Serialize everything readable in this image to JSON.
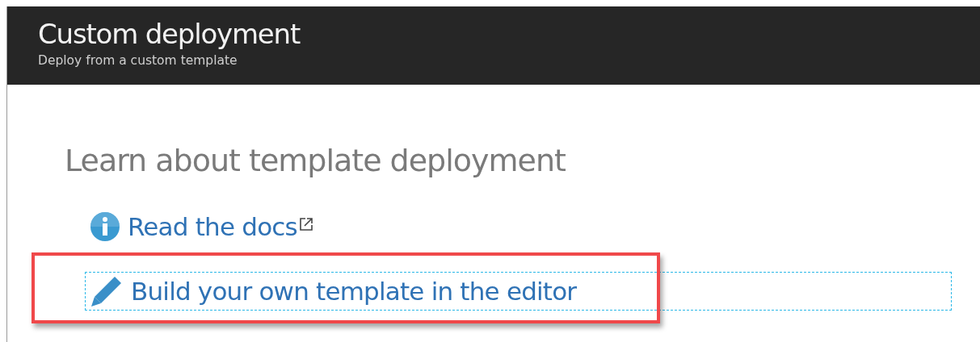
{
  "header": {
    "title": "Custom deployment",
    "subtitle": "Deploy from a custom template"
  },
  "section": {
    "heading": "Learn about template deployment",
    "links": [
      {
        "kind": "info",
        "label": "Read the docs",
        "external": true,
        "focused": false,
        "highlighted": false
      },
      {
        "kind": "edit",
        "label": "Build your own template in the editor",
        "external": false,
        "focused": true,
        "highlighted": true
      }
    ]
  }
}
